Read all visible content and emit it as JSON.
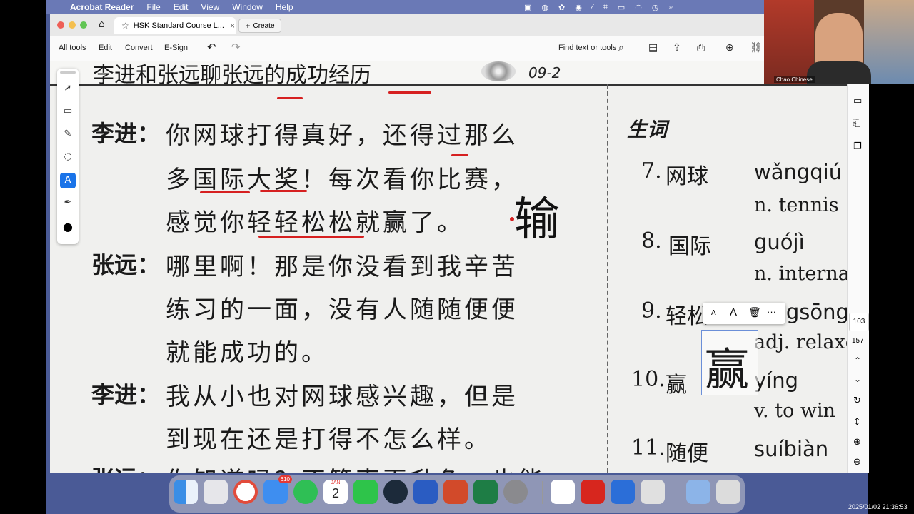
{
  "menubar": {
    "app": "Acrobat Reader",
    "items": [
      "File",
      "Edit",
      "View",
      "Window",
      "Help"
    ]
  },
  "tab": {
    "title": "HSK Standard Course L...",
    "create": "Create"
  },
  "toolbar": {
    "all_tools": "All tools",
    "edit": "Edit",
    "convert": "Convert",
    "esign": "E-Sign",
    "find": "Find text or tools"
  },
  "page_header": {
    "title": "李进和张远聊张远的成功经历",
    "track": "09-2"
  },
  "dialogue": [
    {
      "speaker": "李进：",
      "lines": [
        "你网球打得真好，还得过那么",
        "多国际大奖！每次看你比赛，",
        "感觉你轻轻松松就赢了。"
      ]
    },
    {
      "speaker": "张远：",
      "lines": [
        "哪里啊！那是你没看到我辛苦",
        "练习的一面，没有人随随便便",
        "就能成功的。"
      ]
    },
    {
      "speaker": "李进：",
      "lines": [
        "我从小也对网球感兴趣，但是",
        "到现在还是打得不怎么样。"
      ]
    },
    {
      "speaker": "张远：",
      "lines": [
        "你知道吗？不管声再升色，也能"
      ]
    }
  ],
  "annotation": {
    "text": "输"
  },
  "vocab": {
    "heading": "生词",
    "items": [
      {
        "num": "7.",
        "word": "网球",
        "pinyin": "wǎngqiú",
        "gloss": "n. tennis"
      },
      {
        "num": "8.",
        "word": "国际",
        "pinyin": "guójì",
        "gloss": "n. interna"
      },
      {
        "num": "9.",
        "word": "轻松",
        "pinyin": "qīngsōng",
        "gloss": "adj. relaxe"
      },
      {
        "num": "10.",
        "word": "赢",
        "pinyin": "yíng",
        "gloss": "v. to win"
      },
      {
        "num": "11.",
        "word": "随便",
        "pinyin": "suíbiàn",
        "gloss": ""
      }
    ]
  },
  "text_box": {
    "text": "赢",
    "small_a": "A",
    "large_a": "A",
    "more": "···"
  },
  "page_numbers": {
    "current": "103",
    "total": "157"
  },
  "video": {
    "label": "Chao Chinese"
  },
  "dock": {
    "mail_badge": "610",
    "calendar_month": "JAN",
    "calendar_day": "2"
  },
  "clock": "2025/01/02 21:36:53"
}
